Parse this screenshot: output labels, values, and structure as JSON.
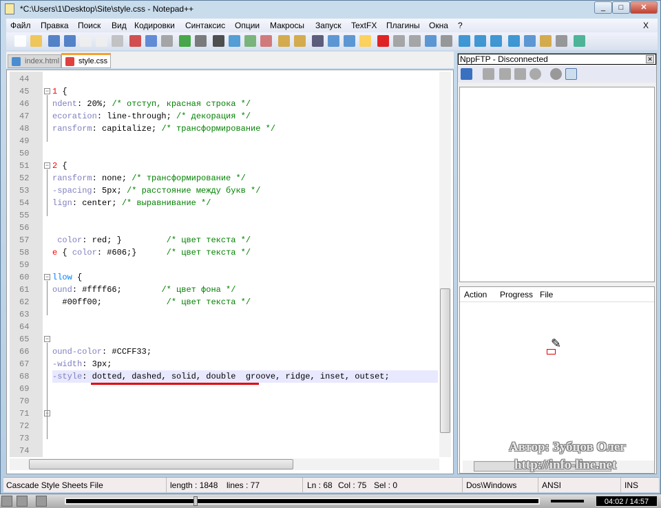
{
  "window": {
    "title": "*C:\\Users\\1\\Desktop\\Site\\style.css - Notepad++",
    "close_x": "X"
  },
  "menu": [
    "Файл",
    "Правка",
    "Поиск",
    "Вид",
    "Кодировки",
    "Синтаксис",
    "Опции",
    "Макросы",
    "Запуск",
    "TextFX",
    "Плагины",
    "Окна",
    "?"
  ],
  "tabs": [
    {
      "label": "index.html",
      "active": false
    },
    {
      "label": "style.css",
      "active": true
    }
  ],
  "editor": {
    "current_line": 68,
    "highlight_text": "dotted, dashed, solid, double",
    "lines": [
      {
        "n": "44",
        "seg": []
      },
      {
        "n": "45",
        "seg": [
          [
            "s",
            "1"
          ],
          [
            "v",
            " {"
          ]
        ],
        "fold": "box"
      },
      {
        "n": "46",
        "seg": [
          [
            "p",
            "ndent"
          ],
          [
            "v",
            ": 20%; "
          ],
          [
            "c",
            "/* отступ, красная строка */"
          ]
        ]
      },
      {
        "n": "47",
        "seg": [
          [
            "p",
            "ecoration"
          ],
          [
            "v",
            ": line-through; "
          ],
          [
            "c",
            "/* декорация */"
          ]
        ]
      },
      {
        "n": "48",
        "seg": [
          [
            "p",
            "ransform"
          ],
          [
            "v",
            ": capitalize; "
          ],
          [
            "c",
            "/* трансформирование */"
          ]
        ]
      },
      {
        "n": "49",
        "seg": []
      },
      {
        "n": "50",
        "seg": []
      },
      {
        "n": "51",
        "seg": [
          [
            "s",
            "2"
          ],
          [
            "v",
            " {"
          ]
        ],
        "fold": "box"
      },
      {
        "n": "52",
        "seg": [
          [
            "p",
            "ransform"
          ],
          [
            "v",
            ": none; "
          ],
          [
            "c",
            "/* трансформирование */"
          ]
        ]
      },
      {
        "n": "53",
        "seg": [
          [
            "p",
            "-spacing"
          ],
          [
            "v",
            ": 5px; "
          ],
          [
            "c",
            "/* расстояние между букв */"
          ]
        ]
      },
      {
        "n": "54",
        "seg": [
          [
            "p",
            "lign"
          ],
          [
            "v",
            ": center; "
          ],
          [
            "c",
            "/* выравнивание */"
          ]
        ]
      },
      {
        "n": "55",
        "seg": []
      },
      {
        "n": "56",
        "seg": []
      },
      {
        "n": "57",
        "seg": [
          [
            "p",
            " color"
          ],
          [
            "v",
            ": red; }         "
          ],
          [
            "c",
            "/* цвет текста */"
          ]
        ]
      },
      {
        "n": "58",
        "seg": [
          [
            "s",
            "e"
          ],
          [
            "v",
            " { "
          ],
          [
            "p",
            "color"
          ],
          [
            "v",
            ": #606;}      "
          ],
          [
            "c",
            "/* цвет текста */"
          ]
        ]
      },
      {
        "n": "59",
        "seg": []
      },
      {
        "n": "60",
        "seg": [
          [
            "k",
            "llow"
          ],
          [
            "v",
            " {"
          ]
        ],
        "fold": "box"
      },
      {
        "n": "61",
        "seg": [
          [
            "p",
            "ound"
          ],
          [
            "v",
            ": #ffff66;        "
          ],
          [
            "c",
            "/* цвет фона */"
          ]
        ]
      },
      {
        "n": "62",
        "seg": [
          [
            "v",
            "  #00ff00;             "
          ],
          [
            "c",
            "/* цвет текста */"
          ]
        ]
      },
      {
        "n": "63",
        "seg": []
      },
      {
        "n": "64",
        "seg": []
      },
      {
        "n": "65",
        "seg": [],
        "fold": "box"
      },
      {
        "n": "66",
        "seg": [
          [
            "p",
            "ound-color"
          ],
          [
            "v",
            ": #CCFF33;"
          ]
        ]
      },
      {
        "n": "67",
        "seg": [
          [
            "p",
            "-width"
          ],
          [
            "v",
            ": 3px;"
          ]
        ]
      },
      {
        "n": "68",
        "seg": [
          [
            "p",
            "-style"
          ],
          [
            "v",
            ": dotted, dashed, solid, double  groove, ridge, inset, outset;"
          ]
        ]
      },
      {
        "n": "69",
        "seg": []
      },
      {
        "n": "70",
        "seg": []
      },
      {
        "n": "71",
        "seg": [],
        "fold": "box"
      },
      {
        "n": "72",
        "seg": []
      },
      {
        "n": "73",
        "seg": []
      },
      {
        "n": "74",
        "seg": []
      }
    ]
  },
  "ftp": {
    "title": "NppFTP - Disconnected",
    "columns": [
      "Action",
      "Progress",
      "File"
    ]
  },
  "watermark": {
    "author": "Автор: Зубцов Олег",
    "url": "http://info-line.net"
  },
  "status": {
    "file_type": "Cascade Style Sheets File",
    "length": "length : 1848",
    "lines": "lines : 77",
    "ln": "Ln : 68",
    "col": "Col : 75",
    "sel": "Sel : 0",
    "eol": "Dos\\Windows",
    "encoding": "ANSI",
    "mode": "INS"
  },
  "media": {
    "time": "04:02 / 14:57",
    "progress": 0.27
  }
}
